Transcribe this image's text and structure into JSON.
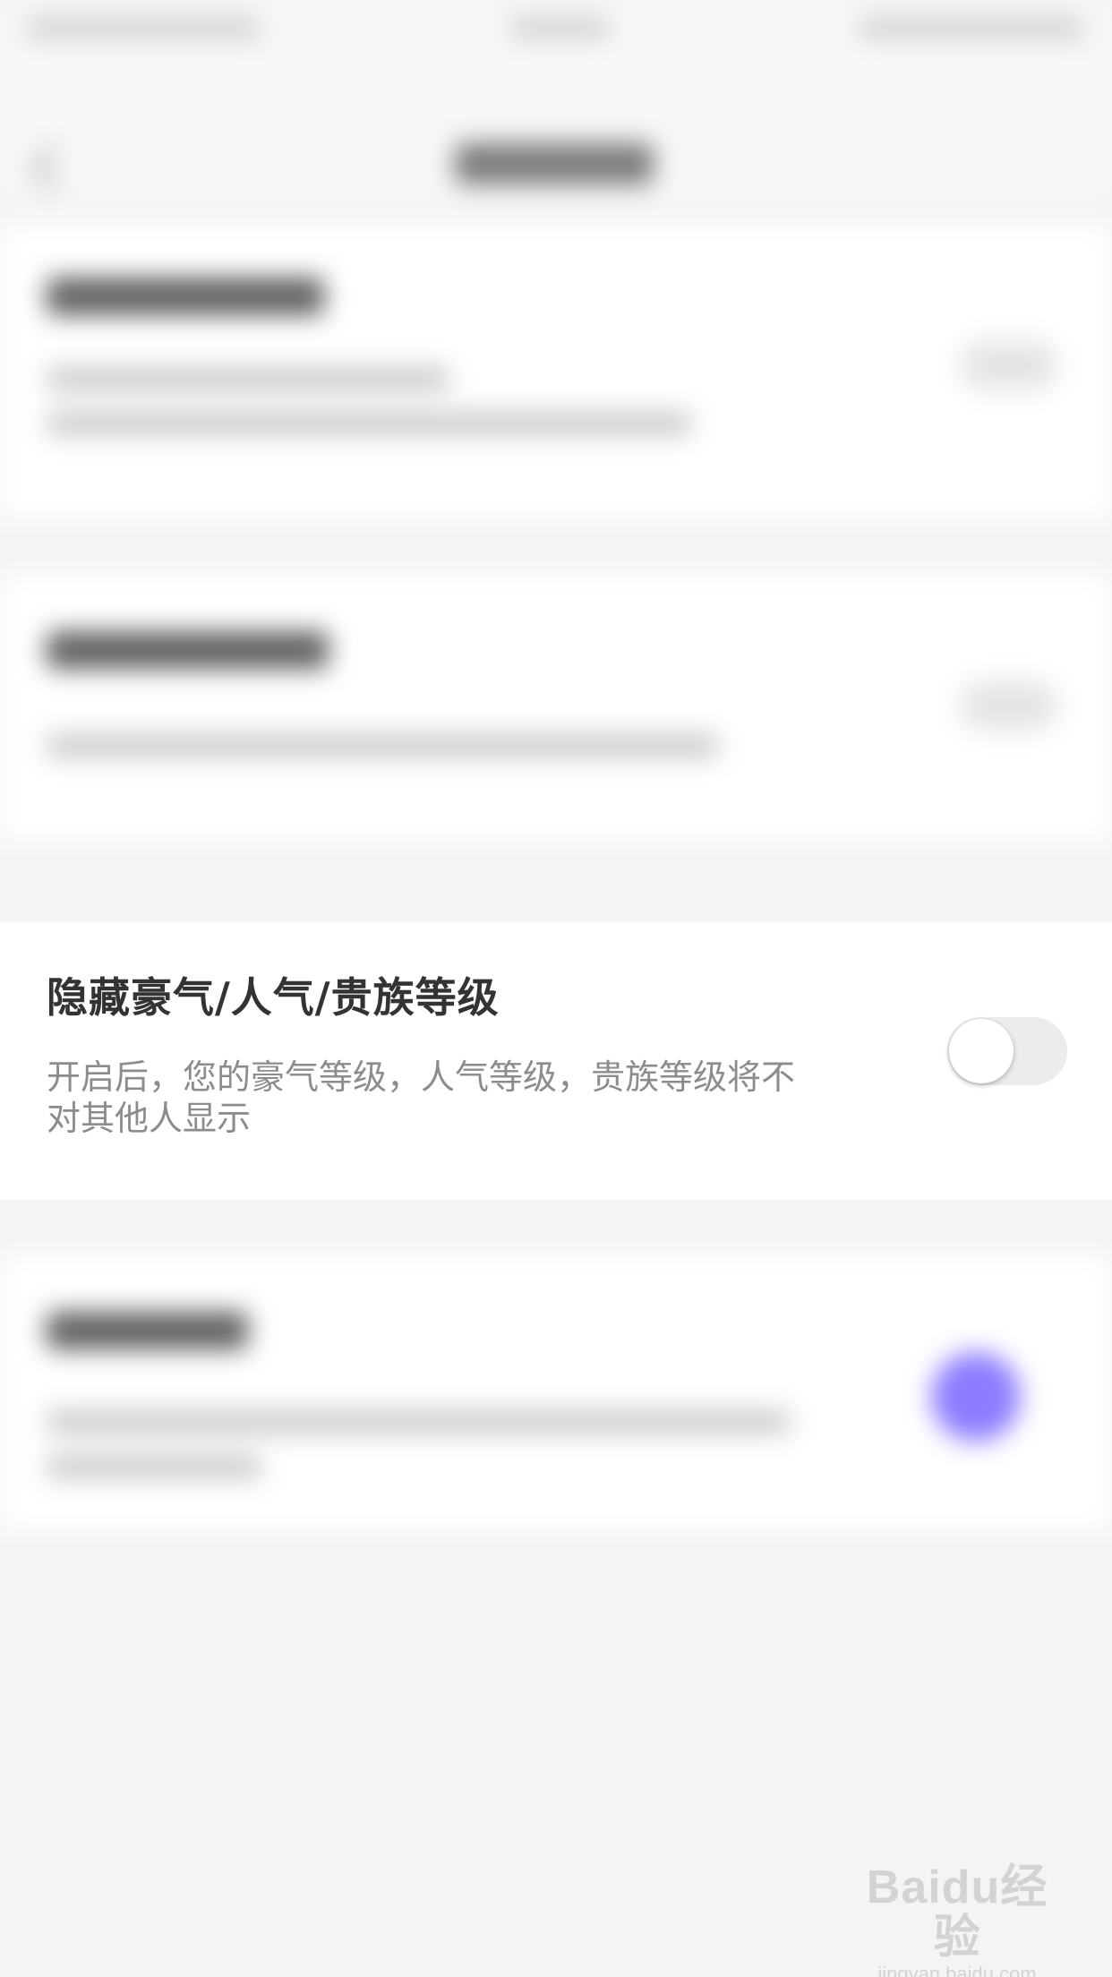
{
  "setting_item": {
    "title": "隐藏豪气/人气/贵族等级",
    "description": "开启后，您的豪气等级，人气等级，贵族等级将不对其他人显示",
    "toggle_state": "off"
  },
  "watermark": {
    "logo_text": "Baidu经验",
    "url_text": "jingyan.baidu.com"
  },
  "colors": {
    "background": "#f4f4f4",
    "card": "#ffffff",
    "title_text": "#333333",
    "description_text": "#8c8c8c",
    "toggle_track_off": "#ececec",
    "toggle_on_accent": "#8c7cff"
  },
  "icons": {
    "back": "chevron-left-icon"
  }
}
